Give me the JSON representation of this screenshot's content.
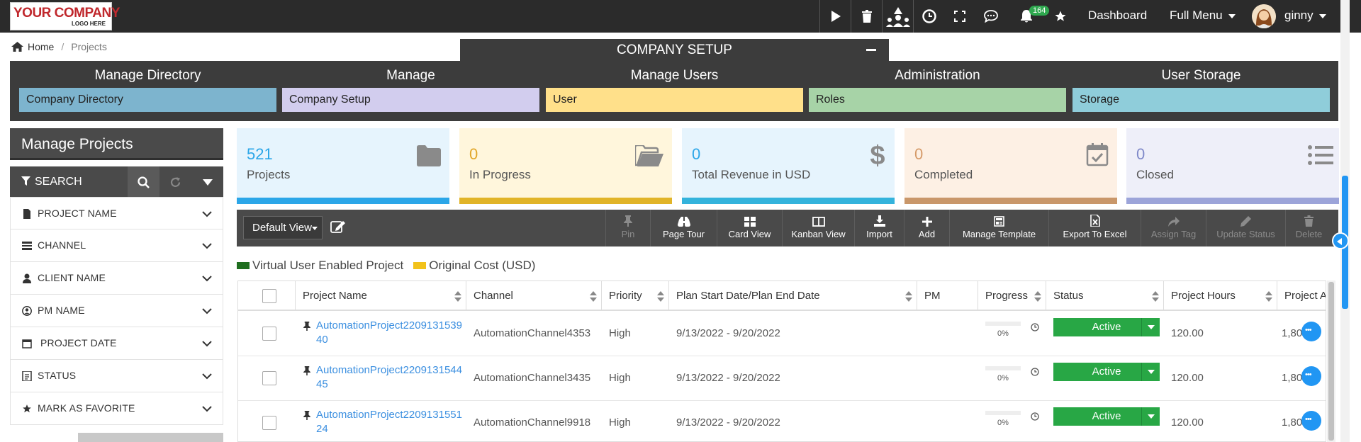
{
  "logo": {
    "line1": "YOUR COMPANY",
    "line2": "LOGO HERE"
  },
  "topbar": {
    "notification_count": "164",
    "dashboard_label": "Dashboard",
    "full_menu_label": "Full Menu",
    "user_name": "ginny"
  },
  "breadcrumb": {
    "home": "Home",
    "current": "Projects"
  },
  "company_setup": {
    "title": "COMPANY SETUP",
    "columns": [
      {
        "header": "Manage Directory",
        "item": "Company Directory",
        "color": "#7db4ce"
      },
      {
        "header": "Manage",
        "item": "Company Setup",
        "color": "#d2cdee"
      },
      {
        "header": "Manage Users",
        "item": "User",
        "color": "#ffe08a"
      },
      {
        "header": "Administration",
        "item": "Roles",
        "color": "#a7d3a7"
      },
      {
        "header": "User Storage",
        "item": "Storage",
        "color": "#8fcdda"
      }
    ]
  },
  "sidebar": {
    "title": "Manage Projects",
    "search_label": "SEARCH",
    "filters": [
      {
        "label": "PROJECT NAME",
        "icon": "file-icon"
      },
      {
        "label": "CHANNEL",
        "icon": "channel-icon"
      },
      {
        "label": "CLIENT NAME",
        "icon": "user-icon"
      },
      {
        "label": "PM NAME",
        "icon": "user-circle-icon"
      },
      {
        "label": "PROJECT DATE",
        "icon": "calendar-icon"
      },
      {
        "label": "STATUS",
        "icon": "document-icon"
      },
      {
        "label": "MARK AS FAVORITE",
        "icon": "star-icon"
      }
    ]
  },
  "stats": [
    {
      "value": "521",
      "label": "Projects",
      "bg": "#e6f4fd",
      "bar": "#2ba6e8",
      "num_color": "#2ba6e8",
      "icon": "folder-icon"
    },
    {
      "value": "0",
      "label": "In Progress",
      "bg": "#fff6dc",
      "bar": "#e1b428",
      "num_color": "#e1a628",
      "icon": "folder-open-icon"
    },
    {
      "value": "0",
      "label": "Total Revenue in USD",
      "bg": "#e6f4fd",
      "bar": "#34b3dc",
      "num_color": "#2ba6e8",
      "icon": "dollar-icon"
    },
    {
      "value": "0",
      "label": "Completed",
      "bg": "#fdf0e4",
      "bar": "#c9976a",
      "num_color": "#d59a68",
      "icon": "calendar-check-icon"
    },
    {
      "value": "0",
      "label": "Closed",
      "bg": "#eeeff9",
      "bar": "#9ca4d9",
      "num_color": "#7f89c9",
      "icon": "list-icon"
    }
  ],
  "toolbar": {
    "view": "Default View",
    "tools": [
      {
        "label": "Pin",
        "enabled": false
      },
      {
        "label": "Page Tour",
        "enabled": true
      },
      {
        "label": "Card View",
        "enabled": true
      },
      {
        "label": "Kanban View",
        "enabled": true
      },
      {
        "label": "Import",
        "enabled": true
      },
      {
        "label": "Add",
        "enabled": true
      },
      {
        "label": "Manage Template",
        "enabled": true
      },
      {
        "label": "Export To Excel",
        "enabled": true
      },
      {
        "label": "Assign Tag",
        "enabled": false
      },
      {
        "label": "Update Status",
        "enabled": false
      },
      {
        "label": "Delete",
        "enabled": false
      }
    ]
  },
  "legend": [
    {
      "label": "Virtual User Enabled Project",
      "color": "#1f6e1f"
    },
    {
      "label": "Original Cost (USD)",
      "color": "#f2c21b"
    }
  ],
  "table": {
    "headers": [
      "Project Name",
      "Channel",
      "Priority",
      "Plan Start Date/Plan End Date",
      "PM",
      "Progress",
      "Status",
      "Project Hours",
      "Project A"
    ],
    "rows": [
      {
        "name1": "AutomationProject2209131539",
        "name2": "40",
        "channel": "AutomationChannel4353",
        "priority": "High",
        "dates": "9/13/2022 - 9/20/2022",
        "progress": "0%",
        "status": "Active",
        "hours": "120.00",
        "amount": "1,80"
      },
      {
        "name1": "AutomationProject2209131544",
        "name2": "45",
        "channel": "AutomationChannel3435",
        "priority": "High",
        "dates": "9/13/2022 - 9/20/2022",
        "progress": "0%",
        "status": "Active",
        "hours": "120.00",
        "amount": "1,80"
      },
      {
        "name1": "AutomationProject2209131551",
        "name2": "24",
        "channel": "AutomationChannel9918",
        "priority": "High",
        "dates": "9/13/2022 - 9/20/2022",
        "progress": "0%",
        "status": "Active",
        "hours": "120.00",
        "amount": "1,80"
      }
    ]
  }
}
